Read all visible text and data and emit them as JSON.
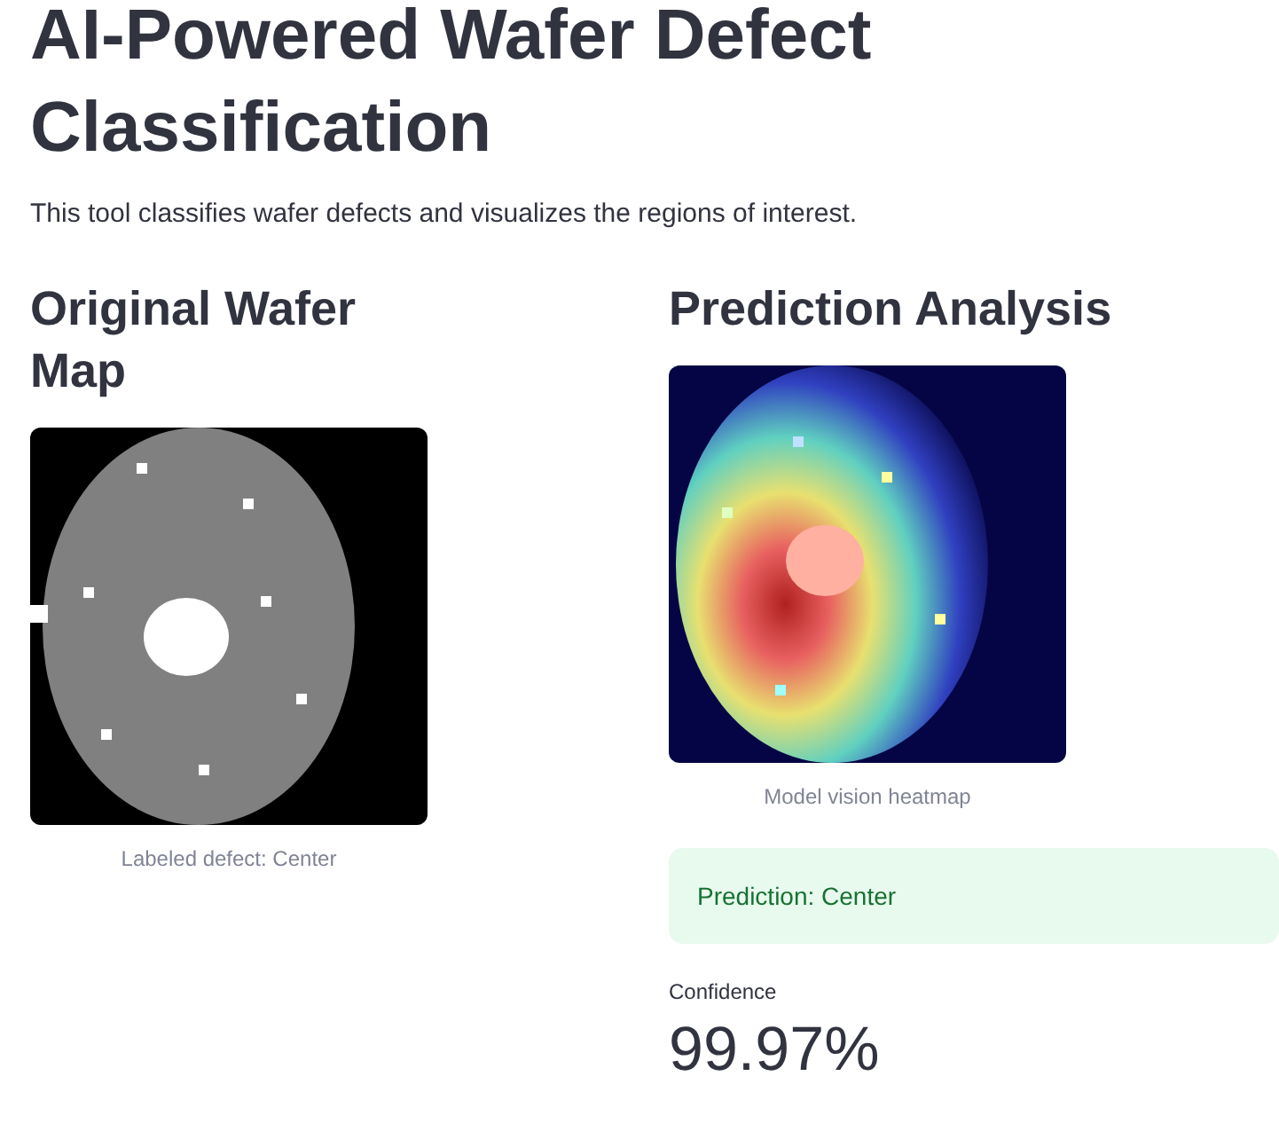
{
  "title": "AI-Powered Wafer Defect Classification",
  "description": "This tool classifies wafer defects and visualizes the regions of interest.",
  "columns": [
    {
      "heading": "Original Wafer Map",
      "image": {
        "kind": "wafer_map"
      },
      "caption": "Labeled defect: Center"
    },
    {
      "heading": "Prediction Analysis",
      "image": {
        "kind": "heatmap"
      },
      "caption": "Model vision heatmap",
      "alert": {
        "kind": "success",
        "text": "Prediction: Center"
      },
      "metric": {
        "label": "Confidence",
        "value": "99.97%"
      }
    }
  ]
}
